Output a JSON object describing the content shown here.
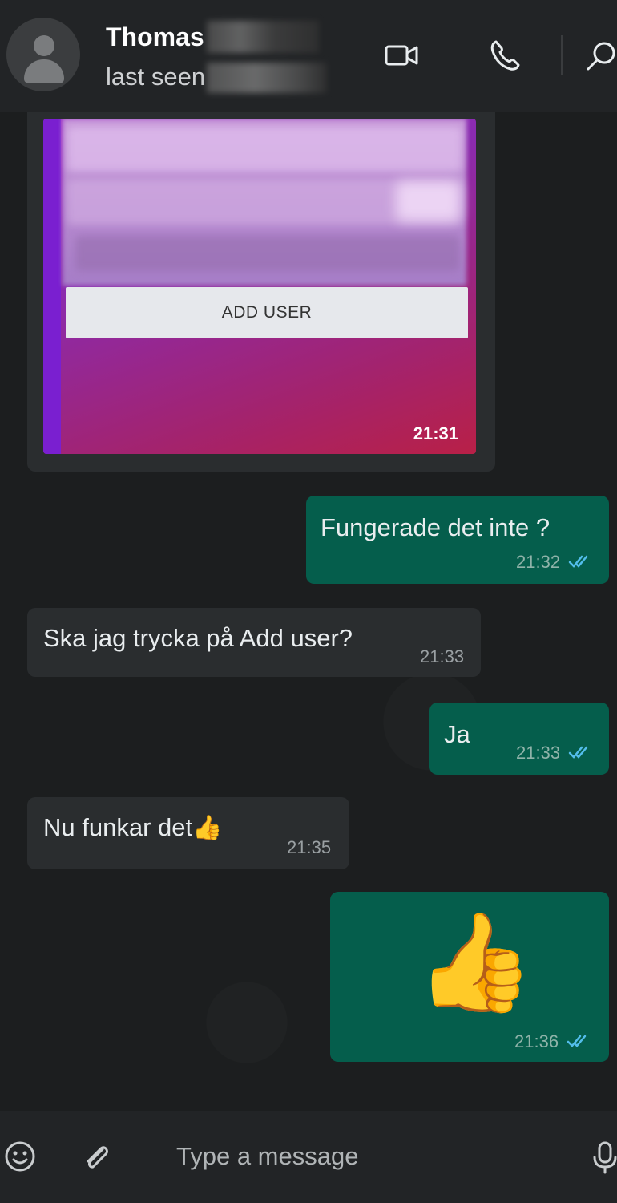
{
  "header": {
    "contact_name": "Thomas",
    "last_seen_prefix": "last seen"
  },
  "messages": [
    {
      "id": "m1",
      "type": "image",
      "direction": "in",
      "image_button_label": "ADD USER",
      "time": "21:31"
    },
    {
      "id": "m2",
      "type": "text",
      "direction": "out",
      "text": "Fungerade det inte ?",
      "time": "21:32",
      "status": "read"
    },
    {
      "id": "m3",
      "type": "text",
      "direction": "in",
      "text": "Ska jag trycka på Add user?",
      "time": "21:33"
    },
    {
      "id": "m4",
      "type": "text",
      "direction": "out",
      "text": "Ja",
      "time": "21:33",
      "status": "read"
    },
    {
      "id": "m5",
      "type": "text",
      "direction": "in",
      "text": "Nu funkar det",
      "emoji": "👍",
      "time": "21:35"
    },
    {
      "id": "m6",
      "type": "emoji",
      "direction": "out",
      "emoji": "👍",
      "time": "21:36",
      "status": "read"
    }
  ],
  "composer": {
    "placeholder": "Type a message"
  },
  "icons": {
    "header": [
      "avatar-icon",
      "video-call-icon",
      "voice-call-icon",
      "search-icon"
    ],
    "footer": [
      "emoji-icon",
      "attach-icon",
      "microphone-icon"
    ],
    "read_receipt": "double-check-icon"
  },
  "colors": {
    "incoming_bubble": "#2a2d2f",
    "outgoing_bubble": "#055e4c",
    "read_tick": "#53bdeb"
  }
}
